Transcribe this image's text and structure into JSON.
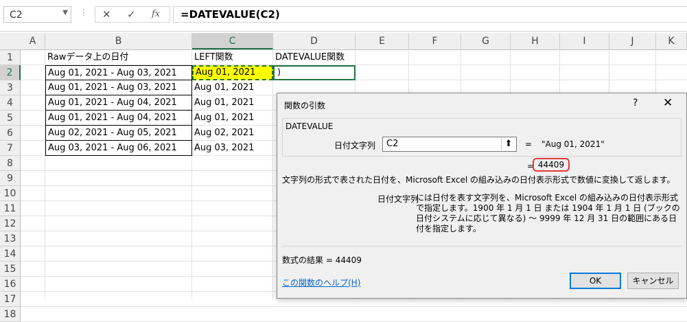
{
  "formula_bar": {
    "name_box": "C2",
    "cancel_glyph": "✕",
    "enter_glyph": "✓",
    "fx_glyph": "fx",
    "formula": "=DATEVALUE(C2)"
  },
  "columns": [
    "A",
    "B",
    "C",
    "D",
    "E",
    "F",
    "G",
    "H",
    "I",
    "J",
    "K"
  ],
  "rows": [
    "1",
    "2",
    "3",
    "4",
    "5",
    "6",
    "7",
    "8",
    "9",
    "10",
    "11",
    "12",
    "13",
    "14",
    "15",
    "16",
    "17",
    "18"
  ],
  "cells": {
    "B1": "Rawデータ上の日付",
    "C1": "LEFT関数",
    "D1": "DATEVALUE関数",
    "B": [
      "Aug 01, 2021 - Aug 03, 2021",
      "Aug 01, 2021 - Aug 03, 2021",
      "Aug 01, 2021 - Aug 04, 2021",
      "Aug 01, 2021 - Aug 04, 2021",
      "Aug 02, 2021 - Aug 05, 2021",
      "Aug 03, 2021 - Aug 06, 2021"
    ],
    "C": [
      "Aug 01, 2021",
      "Aug 01, 2021",
      "Aug 01, 2021",
      "Aug 01, 2021",
      "Aug 02, 2021",
      "Aug 03, 2021"
    ],
    "D2": ")"
  },
  "colors": {
    "highlight": "#ffff00",
    "accent": "#217346",
    "result_circle": "#e53935",
    "link": "#0066cc"
  },
  "dialog": {
    "title": "関数の引数",
    "help": "?",
    "close": "✕",
    "function_name": "DATEVALUE",
    "arg_label": "日付文字列",
    "arg_value": "C2",
    "arg_collapse_icon": "⬆",
    "arg_eq": "=",
    "arg_result": "\"Aug 01, 2021\"",
    "result_eq": "=",
    "result_value": "44409",
    "description": "文字列の形式で表された日付を、Microsoft Excel の組み込みの日付表示形式で数値に変換して返します。",
    "arg_desc_label": "日付文字列",
    "arg_desc": "には日付を表す文字列を、Microsoft Excel の組み込みの日付表示形式で指定します。1900 年 1 月 1 日 または 1904 年 1 月 1 日 (ブックの日付システムに応じて異なる) ～ 9999 年 12 月 31 日の範囲にある日付を指定します。",
    "formula_result": "数式の結果 =   44409",
    "help_link": "この関数のヘルプ(H)",
    "ok": "OK",
    "cancel": "キャンセル"
  }
}
